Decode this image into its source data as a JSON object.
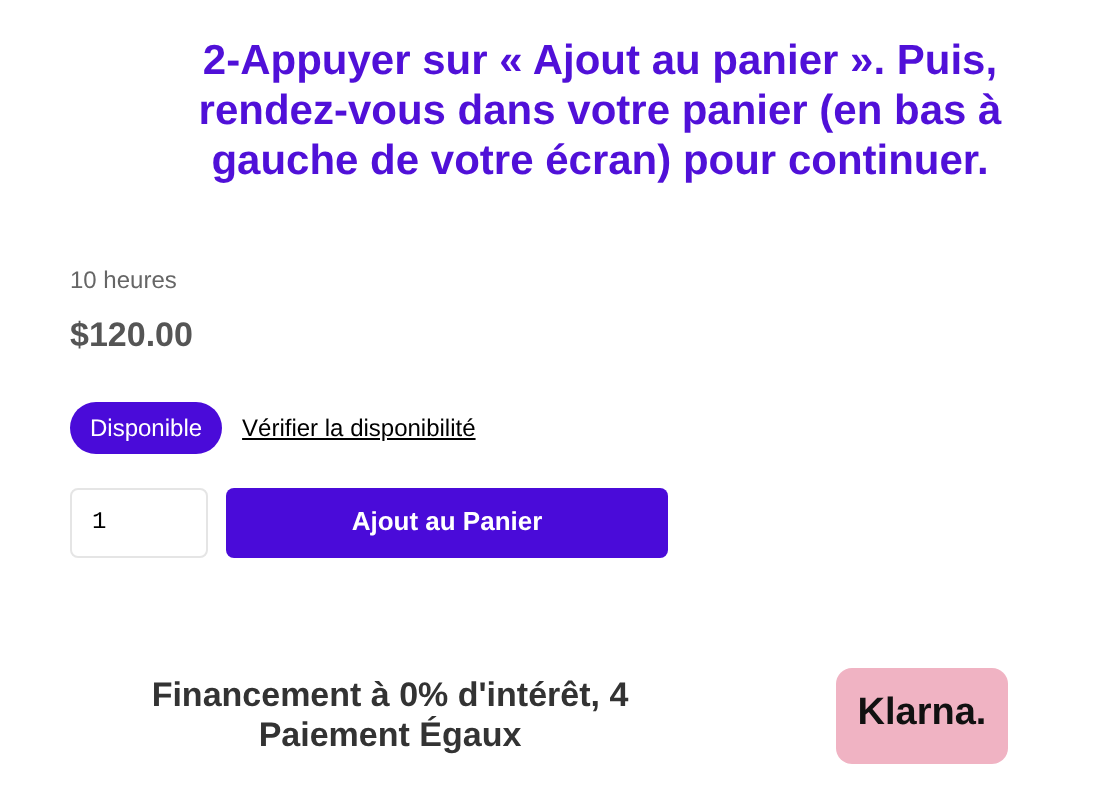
{
  "heading": "2-Appuyer sur « Ajout au panier ». Puis, rendez-vous dans votre panier (en bas à gauche de votre écran) pour continuer.",
  "duration": "10 heures",
  "price": "$120.00",
  "availability": {
    "badge": "Disponible",
    "link": "Vérifier la disponibilité"
  },
  "quantity": {
    "value": "1"
  },
  "add_to_cart": "Ajout au Panier",
  "financing": {
    "text": "Financement à 0% d'intérêt, 4 Paiement Égaux",
    "logo": "Klarna."
  }
}
